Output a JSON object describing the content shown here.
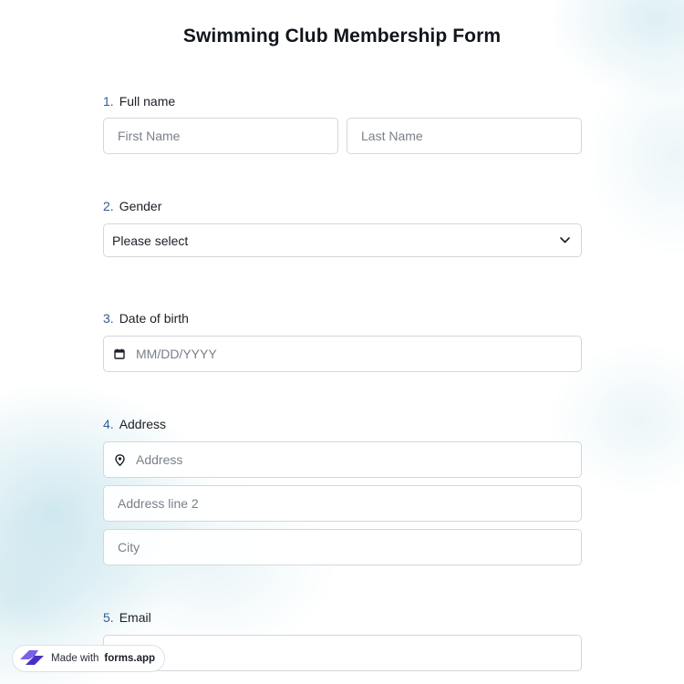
{
  "form": {
    "title": "Swimming Club Membership Form"
  },
  "questions": [
    {
      "number": "1.",
      "label": "Full name",
      "fields": [
        {
          "placeholder": "First Name"
        },
        {
          "placeholder": "Last Name"
        }
      ]
    },
    {
      "number": "2.",
      "label": "Gender",
      "fields": [
        {
          "value": "Please select"
        }
      ]
    },
    {
      "number": "3.",
      "label": "Date of birth",
      "fields": [
        {
          "placeholder": "MM/DD/YYYY",
          "icon": "calendar-icon"
        }
      ]
    },
    {
      "number": "4.",
      "label": "Address",
      "fields": [
        {
          "placeholder": "Address",
          "icon": "map-pin-icon"
        },
        {
          "placeholder": "Address line 2"
        },
        {
          "placeholder": "City"
        }
      ]
    },
    {
      "number": "5.",
      "label": "Email",
      "fields": [
        {
          "placeholder": ""
        }
      ]
    }
  ],
  "footer": {
    "made_with": "Made with",
    "brand": "forms.app"
  },
  "colors": {
    "number_accent": "#2f5d97",
    "brand_logo": "#5b3fd6"
  }
}
